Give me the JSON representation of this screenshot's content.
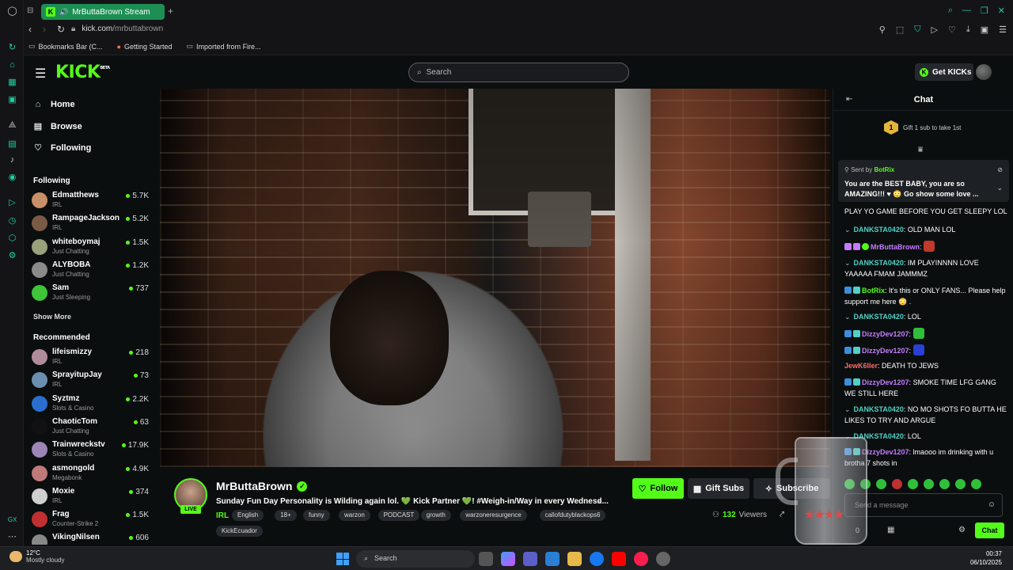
{
  "browser": {
    "tab_title": "MrButtaBrown Stream",
    "url_domain": "kick.com",
    "url_path": "/mrbuttabrown",
    "bookmarks": [
      "Bookmarks Bar (C...",
      "Getting Started",
      "Imported from Fire..."
    ]
  },
  "header": {
    "logo": "KICK",
    "logo_badge": "BETA",
    "search_placeholder": "Search",
    "get_kicks": "Get KICKs"
  },
  "nav": {
    "main": [
      {
        "label": "Home",
        "icon": "home-icon"
      },
      {
        "label": "Browse",
        "icon": "browse-icon"
      },
      {
        "label": "Following",
        "icon": "heart-icon"
      }
    ],
    "following_title": "Following",
    "following": [
      {
        "name": "Edmatthews",
        "category": "IRL",
        "viewers": "5.7K",
        "color": "#c98f68"
      },
      {
        "name": "RampageJackson",
        "category": "IRL",
        "viewers": "5.2K",
        "color": "#7a5a46"
      },
      {
        "name": "whiteboymaj",
        "category": "Just Chatting",
        "viewers": "1.5K",
        "color": "#9aa07a"
      },
      {
        "name": "ALYBOBA",
        "category": "Just Chatting",
        "viewers": "1.2K",
        "color": "#8a8a8a"
      },
      {
        "name": "Sam",
        "category": "Just Sleeping",
        "viewers": "737",
        "color": "#3fc43a"
      }
    ],
    "show_more": "Show More",
    "recommended_title": "Recommended",
    "recommended": [
      {
        "name": "lifeismizzy",
        "category": "IRL",
        "viewers": "218",
        "color": "#b08b9a"
      },
      {
        "name": "SprayitupJay",
        "category": "IRL",
        "viewers": "73",
        "color": "#6b8fb0"
      },
      {
        "name": "Syztmz",
        "category": "Slots & Casino",
        "viewers": "2.2K",
        "color": "#2a6fd0"
      },
      {
        "name": "ChaoticTom",
        "category": "Just Chatting",
        "viewers": "63",
        "color": "#111111"
      },
      {
        "name": "Trainwreckstv",
        "category": "Slots & Casino",
        "viewers": "17.9K",
        "color": "#9c86b8"
      },
      {
        "name": "asmongold",
        "category": "Megabonk",
        "viewers": "4.9K",
        "color": "#c07a7a"
      },
      {
        "name": "Moxie",
        "category": "IRL",
        "viewers": "374",
        "color": "#cfcfcf"
      },
      {
        "name": "Frag",
        "category": "Counter-Strike 2",
        "viewers": "1.5K",
        "color": "#c03030"
      },
      {
        "name": "VikingNilsen",
        "category": "",
        "viewers": "606",
        "color": "#888888"
      }
    ]
  },
  "stream": {
    "streamer": "MrButtaBrown",
    "live_label": "LIVE",
    "title": "Sunday Fun Day Personality is Wilding again lol. 💚 Kick Partner 💚! #Weigh-in/Way in every Wednesd...",
    "category": "IRL",
    "tags": [
      "English",
      "18+",
      "funny",
      "warzon",
      "PODCAST",
      "growth",
      "warzoneresurgence",
      "callofdutyblackops6",
      "KickEcuador"
    ],
    "follow": "Follow",
    "gift_subs": "Gift Subs",
    "subscribe": "Subscribe",
    "viewers_count": "132",
    "viewers_label": "Viewers"
  },
  "chat": {
    "title": "Chat",
    "gift_rank": "1",
    "gift_prompt": "Gift 1 sub to take 1st",
    "pinned": {
      "sent_by": "Sent by",
      "sender": "BotRix",
      "message": "You are the BEST BABY, you are so AMAZING!!! ♥ 😳 Go show some love ..."
    },
    "messages": [
      {
        "user": "",
        "color": "#ffffff",
        "text": "PLAY YO GAME BEFORE YOU GET SLEEPY LOL"
      },
      {
        "user": "DANKSTA0420",
        "color": "#4fd1c5",
        "text": "OLD MAN LOL"
      },
      {
        "user": "MrButtaBrown",
        "color": "#c47cff",
        "text": ""
      },
      {
        "user": "DANKSTA0420",
        "color": "#4fd1c5",
        "text": "IM PLAYINNNN LOVE YAAAAA FMAM JAMMMZ"
      },
      {
        "user": "BotRix",
        "color": "#53fc18",
        "text": "It's this or ONLY FANS... Please help support me here 😳 ."
      },
      {
        "user": "DANKSTA0420",
        "color": "#4fd1c5",
        "text": "LOL"
      },
      {
        "user": "DizzyDev1207",
        "color": "#c47cff",
        "text": ""
      },
      {
        "user": "DizzyDev1207",
        "color": "#c47cff",
        "text": ""
      },
      {
        "user": "JewK6ller",
        "color": "#ff6b6b",
        "text": "DEATH TO JEWS"
      },
      {
        "user": "DizzyDev1207",
        "color": "#c47cff",
        "text": "SMOKE TIME LFG GANG WE STILL HERE"
      },
      {
        "user": "DANKSTA0420",
        "color": "#4fd1c5",
        "text": "NO MO SHOTS FO BUTTA HE LIKES TO TRY AND ARGUE"
      },
      {
        "user": "DANKSTA0420",
        "color": "#4fd1c5",
        "text": "LOL"
      },
      {
        "user": "DizzyDev1207",
        "color": "#c47cff",
        "text": "lmaooo im drinking with u brotha 7 shots in"
      }
    ],
    "input_placeholder": "Send a message",
    "char_count": "0",
    "send": "Chat"
  },
  "taskbar": {
    "temp": "12°C",
    "weather": "Mostly cloudy",
    "search": "Search",
    "time": "00:37",
    "date": "06/10/2025"
  }
}
